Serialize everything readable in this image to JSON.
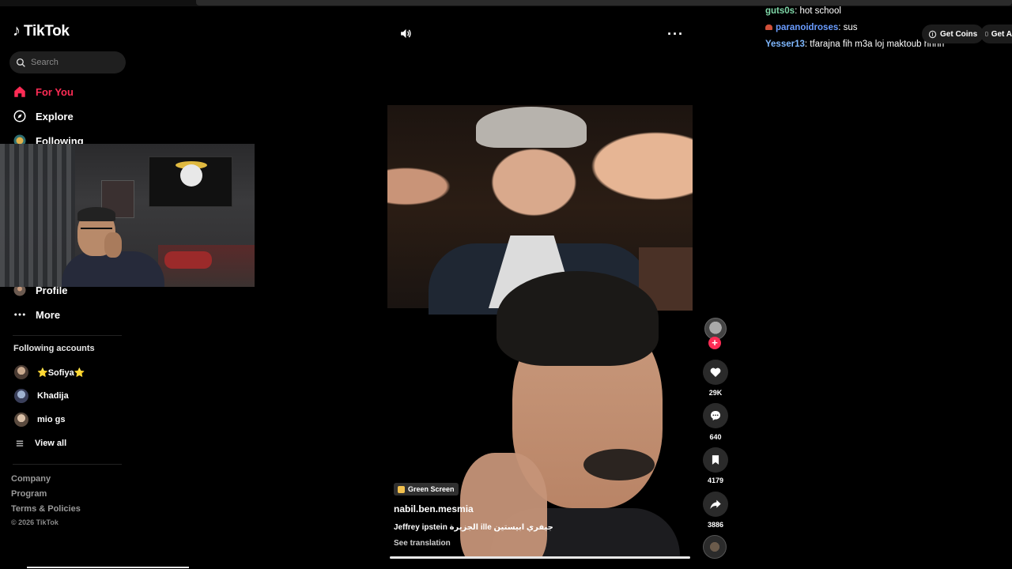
{
  "brand": {
    "name": "TikTok"
  },
  "search": {
    "placeholder": "Search"
  },
  "nav": {
    "for_you": "For You",
    "explore": "Explore",
    "following": "Following",
    "profile": "Profile",
    "more": "More"
  },
  "following_accounts": {
    "title": "Following accounts",
    "items": [
      {
        "name": "⭐Sofiya⭐"
      },
      {
        "name": "Khadija"
      },
      {
        "name": "mio gs"
      }
    ],
    "view_all": "View all"
  },
  "footer": {
    "company": "Company",
    "program": "Program",
    "terms": "Terms & Policies",
    "copyright": "© 2026 TikTok"
  },
  "video": {
    "effect": "Green Screen",
    "username": "nabil.ben.mesmia",
    "caption": "Jeffrey ipstein الجزيرة ille جيفري ابيستين",
    "see_translation": "See translation",
    "progress": 1.0
  },
  "actions": {
    "likes": "29K",
    "comments": "640",
    "saves": "4179",
    "shares": "3886"
  },
  "chat": [
    {
      "user": "guts0s",
      "message": "hot school"
    },
    {
      "user": "paranoidroses",
      "message": "sus"
    },
    {
      "user": "Yesser13",
      "message": "tfarajna fih m3a loj maktoub hhhh"
    }
  ],
  "header_buttons": {
    "get_coins": "Get Coins",
    "get_app": "Get A"
  },
  "colors": {
    "accent": "#fe2c55",
    "background": "#000000"
  }
}
